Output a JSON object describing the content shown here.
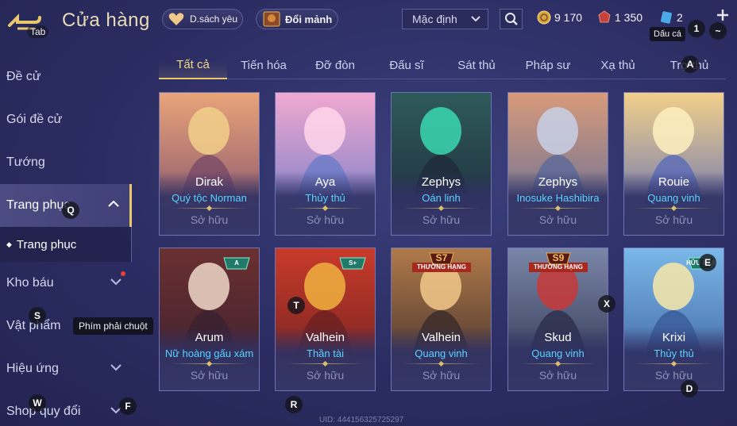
{
  "header": {
    "tab_label": "Tab",
    "title": "Cửa hàng",
    "wishlist_label": "D.sách yêu",
    "exchange_label": "Đổi mảnh",
    "sort_value": "Mặc định",
    "currencies": {
      "gold": "9 170",
      "ruby": "1 350",
      "voucher": "2"
    },
    "tooltip_dau_cach": "Dấu cá",
    "key_1": "1",
    "key_tilde": "~"
  },
  "sidebar": {
    "items": [
      {
        "label": "Đề cử"
      },
      {
        "label": "Gói đề cử"
      },
      {
        "label": "Tướng"
      },
      {
        "label": "Trang phục"
      },
      {
        "label": "Kho báu"
      },
      {
        "label": "Vật phẩm"
      },
      {
        "label": "Hiệu ứng"
      },
      {
        "label": "Shop quy đổi"
      }
    ],
    "sub_item": "Trang phục",
    "tooltip_right_click": "Phím phải chuột"
  },
  "tabs": [
    "Tất cả",
    "Tiến hóa",
    "Đỡ đòn",
    "Đấu sĩ",
    "Sát thủ",
    "Pháp sư",
    "Xạ thủ",
    "Trợ thủ"
  ],
  "cards": [
    {
      "hero": "Dirak",
      "skin": "Quý tộc Norman",
      "status": "Sở hữu"
    },
    {
      "hero": "Aya",
      "skin": "Thủy thủ",
      "status": "Sở hữu"
    },
    {
      "hero": "Zephys",
      "skin": "Oán linh",
      "status": "Sở hữu"
    },
    {
      "hero": "Zephys",
      "skin": "Inosuke Hashibira",
      "status": "Sở hữu"
    },
    {
      "hero": "Rouie",
      "skin": "Quang vinh",
      "status": "Sở hữu"
    },
    {
      "hero": "Arum",
      "skin": "Nữ hoàng gấu xám",
      "status": "Sở hữu",
      "badge": "A"
    },
    {
      "hero": "Valhein",
      "skin": "Thần tài",
      "status": "Sở hữu",
      "badge": "S+"
    },
    {
      "hero": "Valhein",
      "skin": "Quang vinh",
      "status": "Sở hữu",
      "season": "S7",
      "season_sub": "THƯỞNG HẠNG"
    },
    {
      "hero": "Skud",
      "skin": "Quang vinh",
      "status": "Sở hữu",
      "season": "S9",
      "season_sub": "THƯỞNG HẠNG"
    },
    {
      "hero": "Krixi",
      "skin": "Thủy thủ",
      "status": "Sở hữu",
      "badge": "HỮU HẠN"
    }
  ],
  "key_hints": {
    "A": "A",
    "Q": "Q",
    "S": "S",
    "W": "W",
    "F": "F",
    "T": "T",
    "R": "R",
    "X": "X",
    "D": "D",
    "E": "E"
  },
  "uid": "UID: 444156325725297",
  "colors": {
    "accent_gold": "#e8c76d",
    "skin_blue": "#5ad2ff",
    "bg": "#2b2d62"
  }
}
